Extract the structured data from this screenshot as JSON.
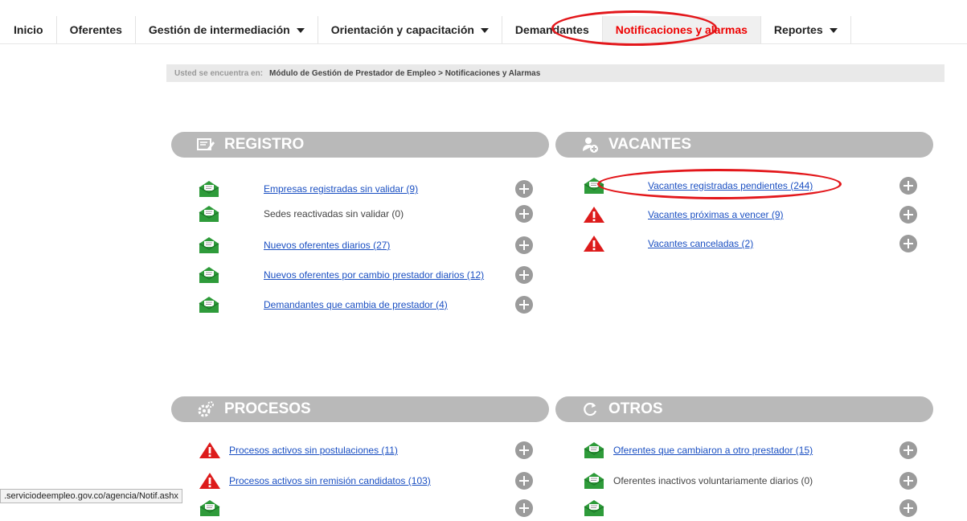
{
  "nav": {
    "items": [
      {
        "label": "Inicio",
        "dropdown": false,
        "active": false
      },
      {
        "label": "Oferentes",
        "dropdown": false,
        "active": false
      },
      {
        "label": "Gestión de intermediación",
        "dropdown": true,
        "active": false
      },
      {
        "label": "Orientación y capacitación",
        "dropdown": true,
        "active": false
      },
      {
        "label": "Demandantes",
        "dropdown": false,
        "active": false
      },
      {
        "label": "Notificaciones y alarmas",
        "dropdown": false,
        "active": true
      },
      {
        "label": "Reportes",
        "dropdown": true,
        "active": false
      }
    ]
  },
  "breadcrumb": {
    "label": "Usted se encuentra en:",
    "path": "Módulo de Gestión de Prestador de Empleo > Notificaciones y Alarmas"
  },
  "panels": {
    "registro": {
      "title": "REGISTRO",
      "icon": "register-icon",
      "items": [
        {
          "label": "Empresas registradas sin validar (9)",
          "icon": "envelope-icon",
          "link": true
        },
        {
          "label": "Sedes reactivadas sin validar (0)",
          "icon": "envelope-icon",
          "link": false
        },
        {
          "label": "Nuevos oferentes diarios (27)",
          "icon": "envelope-icon",
          "link": true
        },
        {
          "label": "Nuevos oferentes por cambio prestador diarios (12)",
          "icon": "envelope-icon",
          "link": true
        },
        {
          "label": "Demandantes que cambia de prestador (4)",
          "icon": "envelope-icon",
          "link": true
        }
      ]
    },
    "vacantes": {
      "title": "VACANTES",
      "icon": "vacancy-icon",
      "items": [
        {
          "label": "Vacantes registradas pendientes (244)",
          "icon": "envelope-icon",
          "link": true
        },
        {
          "label": "Vacantes próximas a vencer (9)",
          "icon": "warning-icon",
          "link": true
        },
        {
          "label": "Vacantes canceladas (2)",
          "icon": "warning-icon",
          "link": true
        }
      ]
    },
    "procesos": {
      "title": "PROCESOS",
      "icon": "gears-icon",
      "items": [
        {
          "label": "Procesos activos sin postulaciones (11)",
          "icon": "warning-icon",
          "link": true
        },
        {
          "label": "Procesos activos sin remisión candidatos (103)",
          "icon": "warning-icon",
          "link": true
        }
      ]
    },
    "otros": {
      "title": "OTROS",
      "icon": "refresh-icon",
      "items": [
        {
          "label": "Oferentes que cambiaron a otro prestador (15)",
          "icon": "envelope-icon",
          "link": true
        },
        {
          "label": "Oferentes inactivos voluntariamente diarios (0)",
          "icon": "envelope-icon",
          "link": false
        }
      ]
    }
  },
  "status_bar": {
    "url": ".serviciodeempleo.gov.co/agencia/Notif.ashx"
  },
  "colors": {
    "accent": "#e3171b",
    "link": "#1a4fc2",
    "header_bg": "#b9b9b9",
    "envelope": "#2e9b3a",
    "warning": "#dd1b1b"
  }
}
